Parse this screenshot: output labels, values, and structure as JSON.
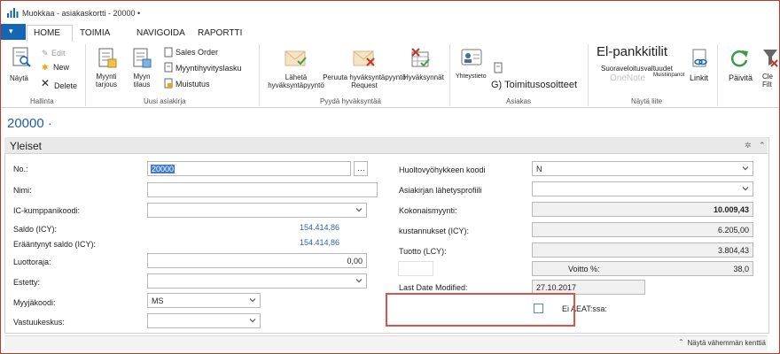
{
  "window": {
    "title": "Muokkaa - asiakaskortti - 20000 •"
  },
  "tabs": [
    {
      "label": "HOME"
    },
    {
      "label": "TOIMIA"
    },
    {
      "label": "NAVIGOIDA"
    },
    {
      "label": "RAPORTTI"
    }
  ],
  "ribbon": {
    "hallinta": {
      "group_label": "Hallinta",
      "view_label": "Näytä",
      "edit_label": "Edit",
      "new_label": "New",
      "delete_label": "Delete"
    },
    "uusi": {
      "group_label": "Uusi asiakirja",
      "quote_label": "Myynti tarjous",
      "order_label": "Myyn tilaus",
      "sales_order_label": "Sales Order",
      "credit_memo_label": "Myyntihyvityslasku",
      "reminder_label": "Muistutus"
    },
    "pyyda": {
      "group_label": "Pyydä hyväksyntää",
      "send_label": "Lähetä hyväksyntäpyyntö",
      "cancel_label": "Peruuta hyväksyntäpyyntö Request",
      "approvals_label": "Hyväksynnät"
    },
    "asiakas": {
      "group_label": "Asiakas",
      "contact_label": "Yhteystieto",
      "ship_to_label": "G) Toimitusosoitteet"
    },
    "nayta": {
      "group_label": "Näytä liite",
      "bank_label": "El-pankkitilit",
      "direct_debit_label": "Suoraveloitusvaltuudet",
      "onenote_label": "OneNote",
      "notes_label": "Muistiinpanot",
      "links_label": "Linkit"
    },
    "refresh_label": "Päivitä",
    "clear_filter_label": "Cle Filt"
  },
  "page": {
    "title": "20000 ·"
  },
  "fasttab": {
    "caption": "Yleiset",
    "footer": "Näytä vähemmän kenttiä"
  },
  "left_fields": {
    "no_label": "No.:",
    "no_value": "20000",
    "name_label": "Nimi:",
    "ic_label": "IC-kumppanikoodi:",
    "balance_label": "Saldo (ICY):",
    "balance_value": "154.414,86",
    "overdue_label": "Erääntynyt saldo (ICY):",
    "overdue_value": "154.414,86",
    "credit_label": "Luottoraja:",
    "credit_value": "0,00",
    "blocked_label": "Estetty:",
    "salesperson_label": "Myyjäkoodi:",
    "salesperson_value": "MS",
    "resp_label": "Vastuukeskus:"
  },
  "right_fields": {
    "service_zone_label": "Huoltovyöhykkeen koodi",
    "service_zone_value": "N",
    "doc_profile_label": "Asiakirjan lähetysprofiili",
    "total_sales_label": "Kokonaismyynti:",
    "total_sales_value": "10.009,43",
    "costs_label": "kustannukset (ICY):",
    "costs_value": "6.205,00",
    "profit_label": "Tuotto (LCY):",
    "profit_value": "3.804,43",
    "profit_pct_label": "Voitto %:",
    "profit_pct_value": "38,0",
    "modified_label": "Last Date Modified:",
    "modified_value": "27.10.2017",
    "aeat_label": "Ei AEAT:ssa:"
  },
  "colors": {
    "accent": "#1565b5",
    "title_blue": "#1f5d9c",
    "amount_blue": "#2b63a8",
    "highlight": "#d9534f"
  }
}
